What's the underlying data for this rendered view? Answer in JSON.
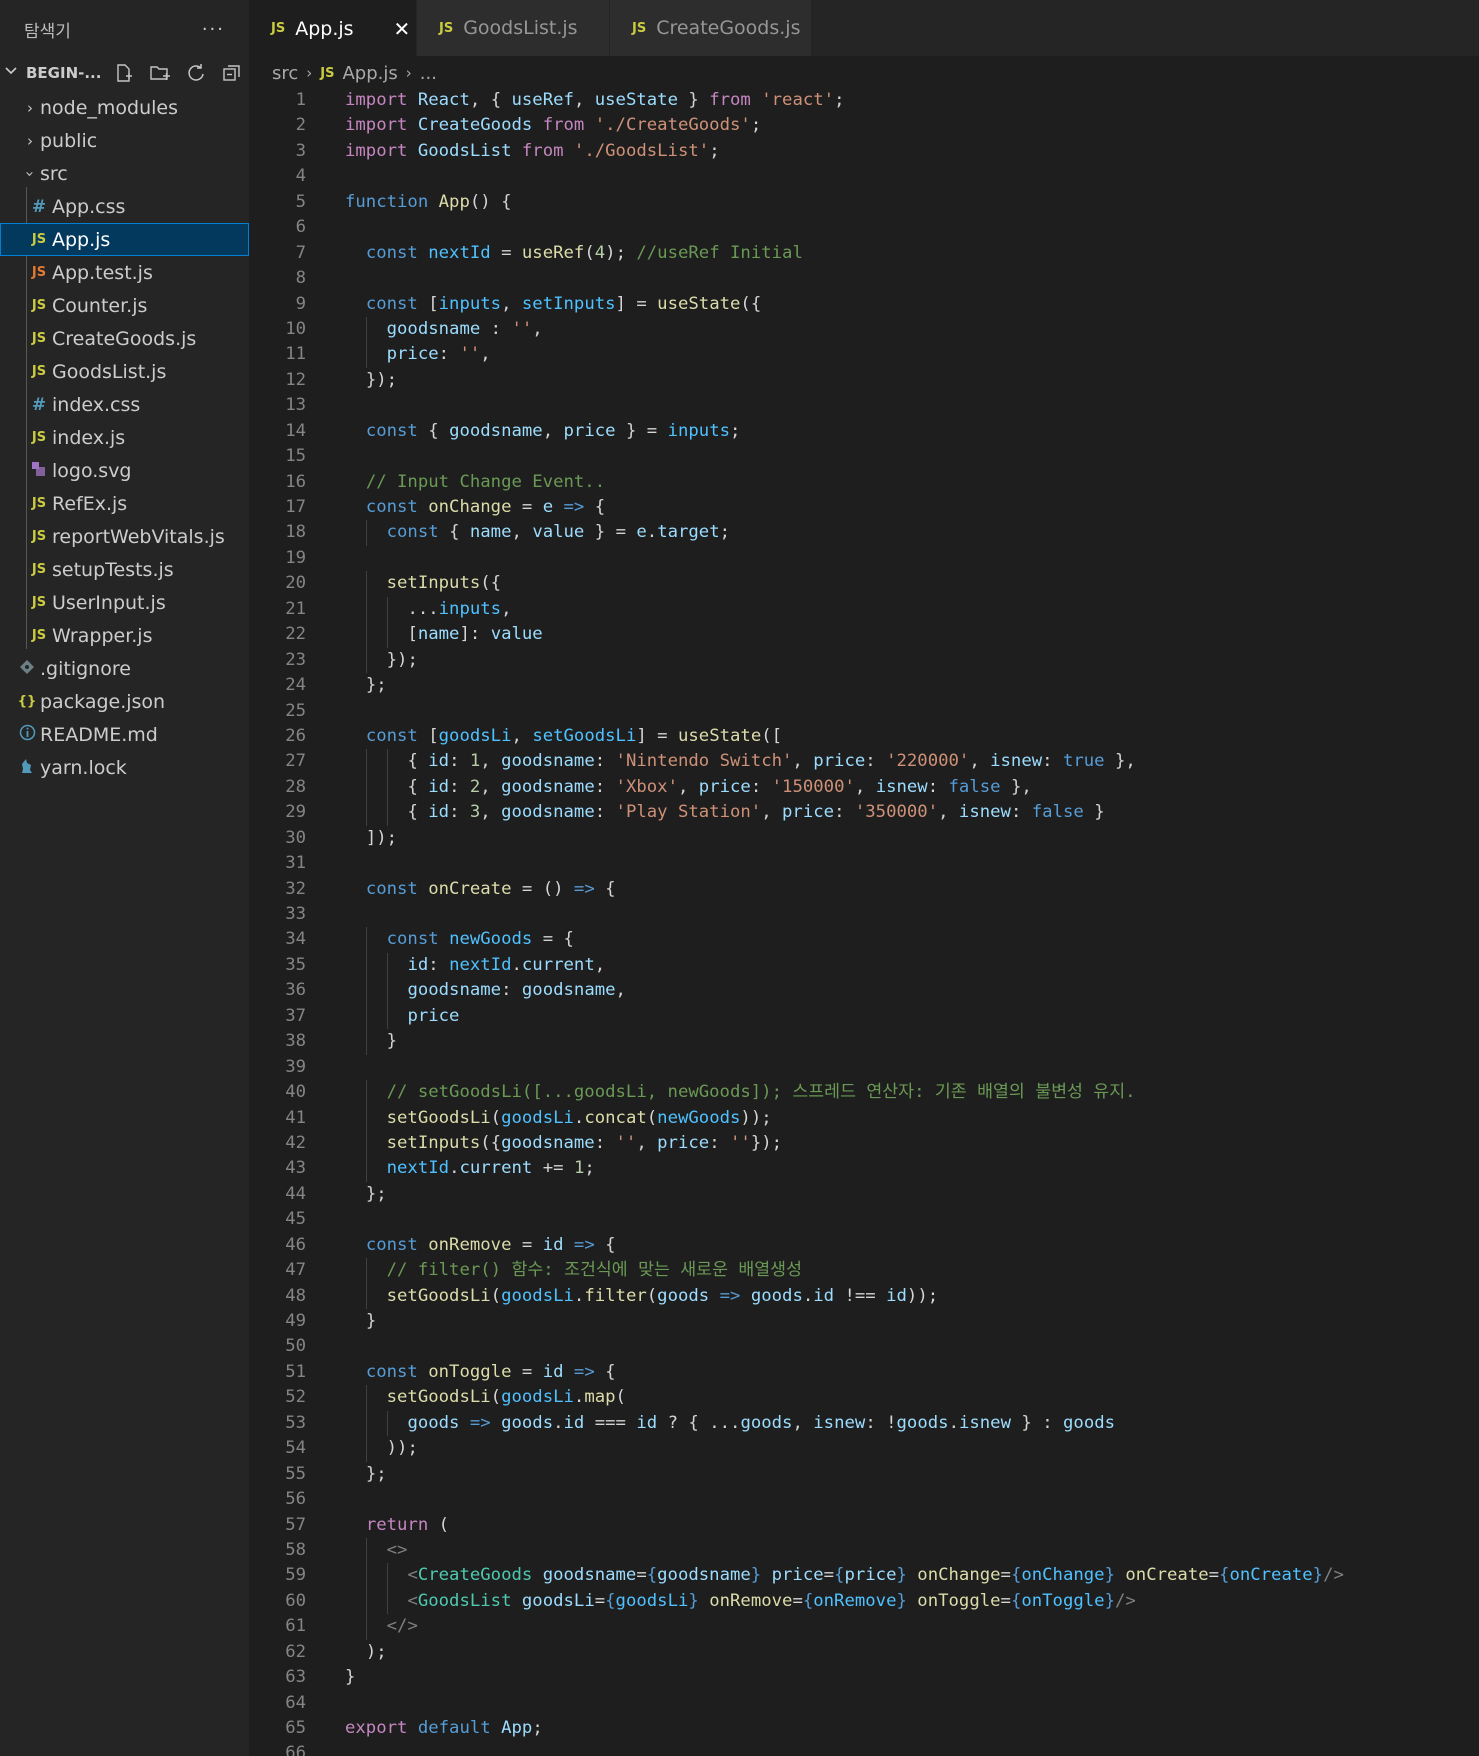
{
  "sidebar": {
    "title": "탐색기",
    "more": "···",
    "project": "BEGIN-...",
    "items": [
      {
        "label": "node_modules",
        "type": "folder",
        "icon": "chevron-right"
      },
      {
        "label": "public",
        "type": "folder",
        "icon": "chevron-right"
      },
      {
        "label": "src",
        "type": "folder-open",
        "icon": "chevron-down"
      },
      {
        "label": "App.css",
        "icon": "css"
      },
      {
        "label": "App.js",
        "icon": "js",
        "selected": true
      },
      {
        "label": "App.test.js",
        "icon": "js-test"
      },
      {
        "label": "Counter.js",
        "icon": "js"
      },
      {
        "label": "CreateGoods.js",
        "icon": "js"
      },
      {
        "label": "GoodsList.js",
        "icon": "js"
      },
      {
        "label": "index.css",
        "icon": "css"
      },
      {
        "label": "index.js",
        "icon": "js"
      },
      {
        "label": "logo.svg",
        "icon": "svg"
      },
      {
        "label": "RefEx.js",
        "icon": "js"
      },
      {
        "label": "reportWebVitals.js",
        "icon": "js"
      },
      {
        "label": "setupTests.js",
        "icon": "js"
      },
      {
        "label": "UserInput.js",
        "icon": "js"
      },
      {
        "label": "Wrapper.js",
        "icon": "js"
      },
      {
        "label": ".gitignore",
        "icon": "git"
      },
      {
        "label": "package.json",
        "icon": "json"
      },
      {
        "label": "README.md",
        "icon": "info"
      },
      {
        "label": "yarn.lock",
        "icon": "yarn"
      }
    ]
  },
  "tabs": [
    {
      "label": "App.js",
      "badge": "JS",
      "active": true
    },
    {
      "label": "GoodsList.js",
      "badge": "JS"
    },
    {
      "label": "CreateGoods.js",
      "badge": "JS"
    }
  ],
  "breadcrumb": {
    "folder": "src",
    "badge": "JS",
    "file": "App.js",
    "more": "..."
  },
  "editor": {
    "line_numbers": [
      "1",
      "2",
      "3",
      "4",
      "5",
      "6",
      "7",
      "8",
      "9",
      "10",
      "11",
      "12",
      "13",
      "14",
      "15",
      "16",
      "17",
      "18",
      "19",
      "20",
      "21",
      "22",
      "23",
      "24",
      "25",
      "26",
      "27",
      "28",
      "29",
      "30",
      "31",
      "32",
      "33",
      "34",
      "35",
      "36",
      "37",
      "38",
      "39",
      "40",
      "41",
      "42",
      "43",
      "44",
      "45",
      "46",
      "47",
      "48",
      "49",
      "50",
      "51",
      "52",
      "53",
      "54",
      "55",
      "56",
      "57",
      "58",
      "59",
      "60",
      "61",
      "62",
      "63",
      "64",
      "65",
      "66"
    ],
    "lines": [
      "import React, { useRef, useState } from 'react';",
      "import CreateGoods from './CreateGoods';",
      "import GoodsList from './GoodsList';",
      "",
      "function App() {",
      "",
      "  const nextId = useRef(4); //useRef Initial",
      "",
      "  const [inputs, setInputs] = useState({",
      "    goodsname : '',",
      "    price: '',",
      "  });",
      "",
      "  const { goodsname, price } = inputs;",
      "",
      "  // Input Change Event..",
      "  const onChange = e => {",
      "    const { name, value } = e.target;",
      "",
      "    setInputs({",
      "      ...inputs,",
      "      [name]: value",
      "    });",
      "  };",
      "",
      "  const [goodsLi, setGoodsLi] = useState([",
      "      { id: 1, goodsname: 'Nintendo Switch', price: '220000', isnew: true },",
      "      { id: 2, goodsname: 'Xbox', price: '150000', isnew: false },",
      "      { id: 3, goodsname: 'Play Station', price: '350000', isnew: false }",
      "  ]);",
      "",
      "  const onCreate = () => {",
      "",
      "    const newGoods = {",
      "      id: nextId.current,",
      "      goodsname: goodsname,",
      "      price",
      "    }",
      "",
      "    // setGoodsLi([...goodsLi, newGoods]); 스프레드 연산자: 기존 배열의 불변성 유지.",
      "    setGoodsLi(goodsLi.concat(newGoods));",
      "    setInputs({goodsname: '', price: ''});",
      "    nextId.current += 1;",
      "  };",
      "",
      "  const onRemove = id => {",
      "    // filter() 함수: 조건식에 맞는 새로운 배열생성",
      "    setGoodsLi(goodsLi.filter(goods => goods.id !== id));",
      "  }",
      "",
      "  const onToggle = id => {",
      "    setGoodsLi(goodsLi.map(",
      "      goods => goods.id === id ? { ...goods, isnew: !goods.isnew } : goods",
      "    ));",
      "  };",
      "",
      "  return (",
      "    <>",
      "      <CreateGoods goodsname={goodsname} price={price} onChange={onChange} onCreate={onCreate}/>",
      "      <GoodsList goodsLi={goodsLi} onRemove={onRemove} onToggle={onToggle}/>",
      "    </>",
      "  );",
      "}",
      "",
      "export default App;",
      ""
    ]
  },
  "colors": {
    "background": "#1e1e1e",
    "sidebar": "#252526",
    "selection": "#04395e",
    "keyword": "#569cd6",
    "control": "#c586c0",
    "string": "#ce9178",
    "function": "#dcdcaa",
    "variable": "#9cdcfe",
    "comment": "#6a9955",
    "number": "#b5cea8",
    "tag": "#4ec9b0"
  }
}
